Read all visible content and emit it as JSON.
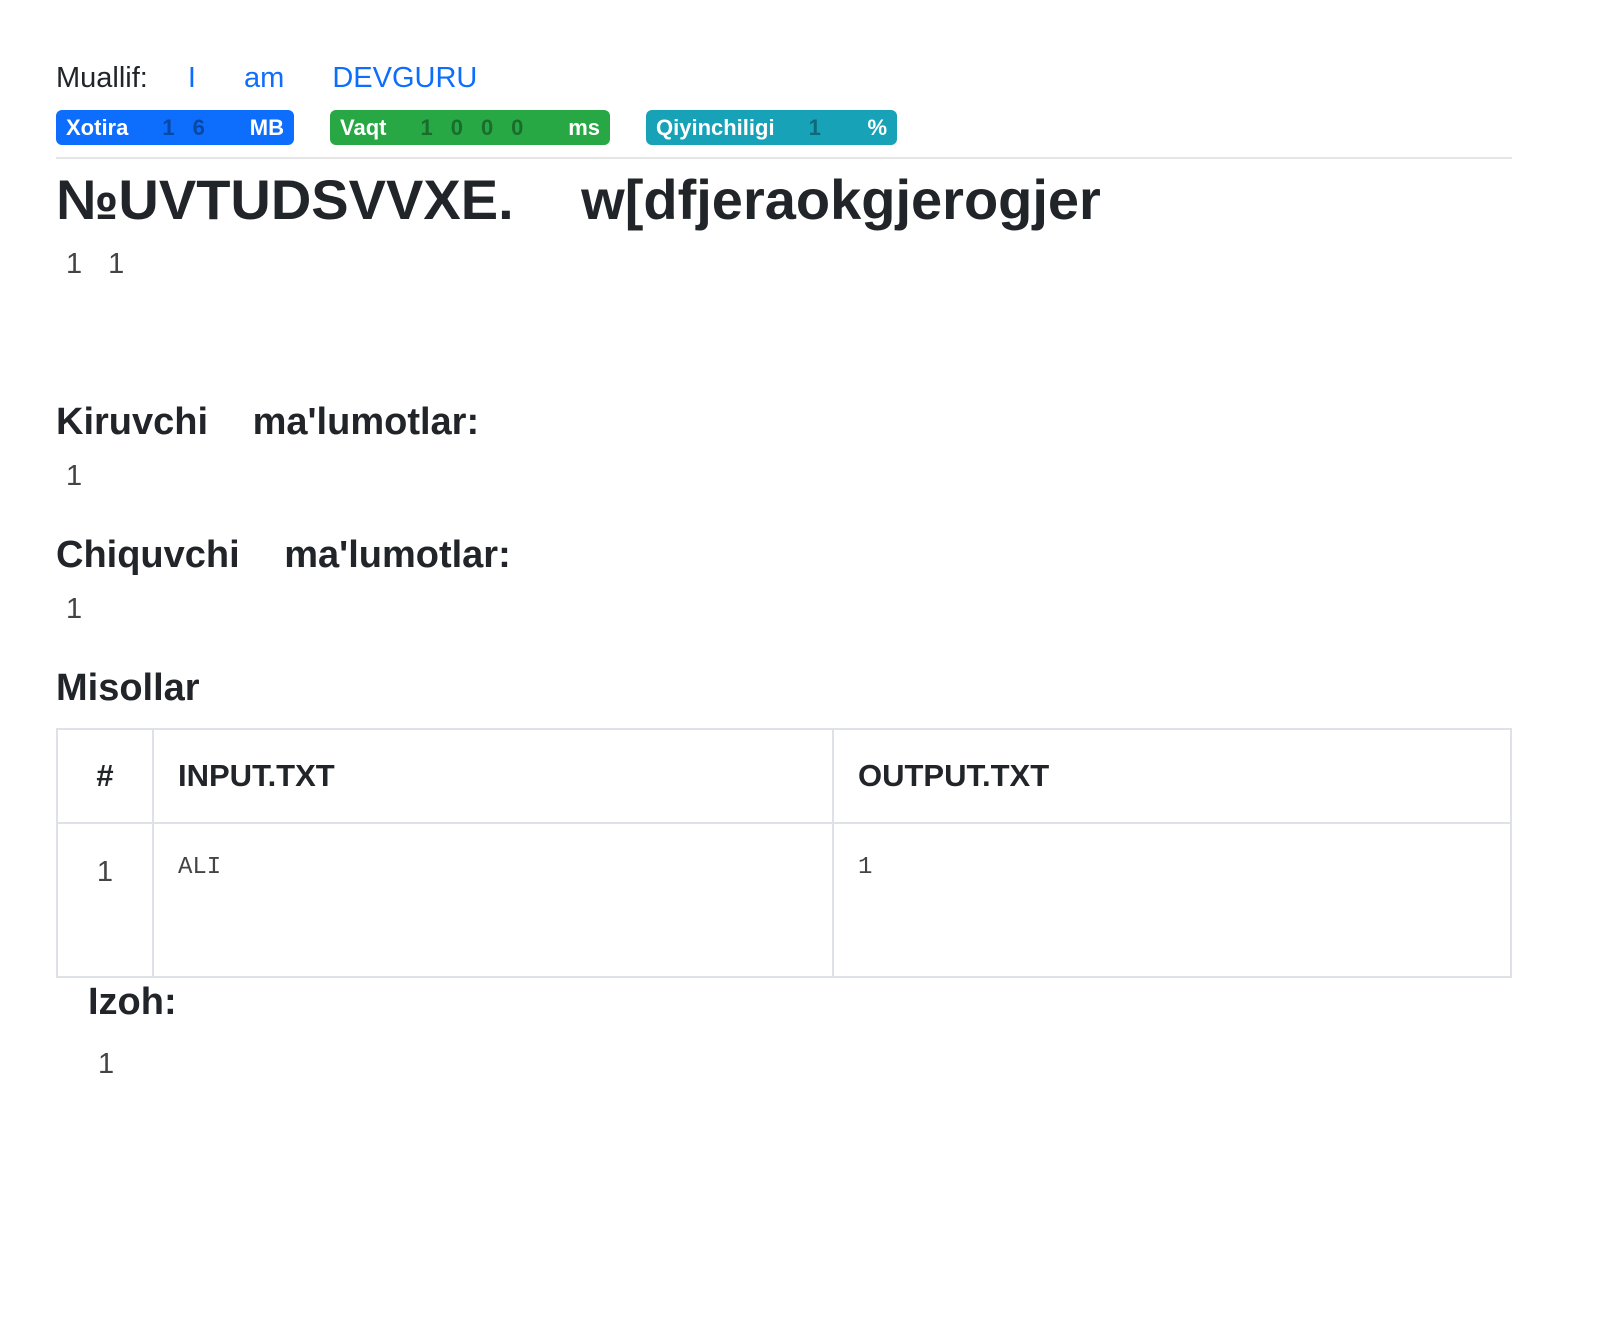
{
  "author": {
    "label": "Muallif:",
    "name": "I am DEVGURU"
  },
  "badges": {
    "memory": {
      "label": "Xotira",
      "value": "16",
      "unit": "MB",
      "color": "#0d6efd"
    },
    "time": {
      "label": "Vaqt",
      "value": "1000",
      "unit": "ms",
      "color": "#28a745"
    },
    "difficulty": {
      "label": "Qiyinchiligi",
      "value": "1",
      "unit": "%",
      "color": "#17a2b8"
    }
  },
  "problem": {
    "title": "№UVTUDSVVXE. w[dfjeraokgjerogjer",
    "body": "1 1"
  },
  "input_section": {
    "heading": "Kiruvchi ma'lumotlar:",
    "text": "1"
  },
  "output_section": {
    "heading": "Chiquvchi ma'lumotlar:",
    "text": "1"
  },
  "examples": {
    "heading": "Misollar",
    "columns": [
      "#",
      "INPUT.TXT",
      "OUTPUT.TXT"
    ],
    "rows": [
      {
        "num": "1",
        "input": "ALI",
        "output": "1"
      }
    ]
  },
  "note": {
    "heading": "Izoh:",
    "text": "1"
  }
}
